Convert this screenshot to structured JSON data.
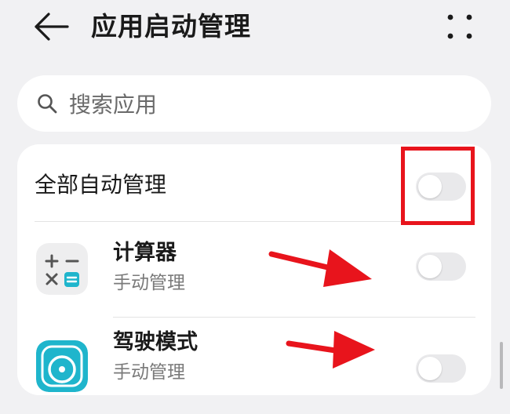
{
  "header": {
    "title": "应用启动管理",
    "back_icon": "arrow-left-icon",
    "more_icon": "more-dots-icon"
  },
  "search": {
    "placeholder": "搜索应用",
    "value": ""
  },
  "all_auto": {
    "label": "全部自动管理",
    "enabled": false
  },
  "apps": [
    {
      "name": "计算器",
      "status": "手动管理",
      "icon": "calculator-icon",
      "enabled": false
    },
    {
      "name": "驾驶模式",
      "status": "手动管理",
      "icon": "steering-wheel-icon",
      "enabled": false
    }
  ],
  "colors": {
    "background": "#f1f1f3",
    "card": "#ffffff",
    "highlight": "#e8141c",
    "toggle_off": "#e9e9eb",
    "accent_teal": "#1fb5cc"
  }
}
